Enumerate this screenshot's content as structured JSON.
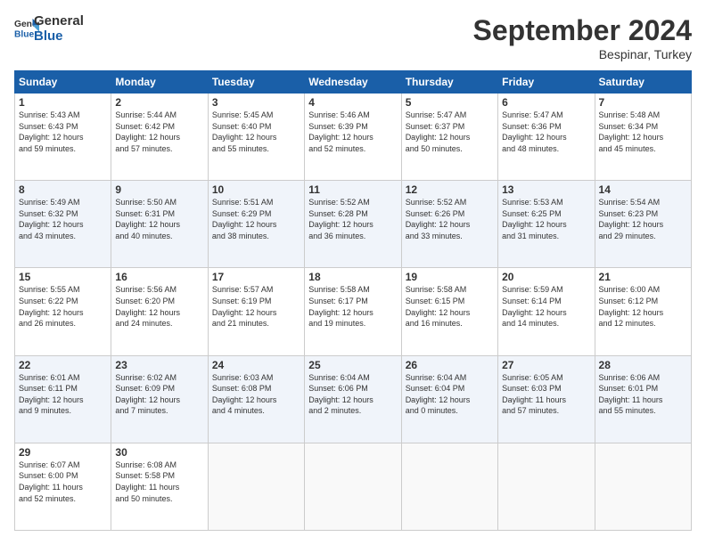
{
  "logo": {
    "line1": "General",
    "line2": "Blue"
  },
  "title": "September 2024",
  "subtitle": "Bespinar, Turkey",
  "weekdays": [
    "Sunday",
    "Monday",
    "Tuesday",
    "Wednesday",
    "Thursday",
    "Friday",
    "Saturday"
  ],
  "weeks": [
    [
      {
        "day": "1",
        "info": "Sunrise: 5:43 AM\nSunset: 6:43 PM\nDaylight: 12 hours\nand 59 minutes."
      },
      {
        "day": "2",
        "info": "Sunrise: 5:44 AM\nSunset: 6:42 PM\nDaylight: 12 hours\nand 57 minutes."
      },
      {
        "day": "3",
        "info": "Sunrise: 5:45 AM\nSunset: 6:40 PM\nDaylight: 12 hours\nand 55 minutes."
      },
      {
        "day": "4",
        "info": "Sunrise: 5:46 AM\nSunset: 6:39 PM\nDaylight: 12 hours\nand 52 minutes."
      },
      {
        "day": "5",
        "info": "Sunrise: 5:47 AM\nSunset: 6:37 PM\nDaylight: 12 hours\nand 50 minutes."
      },
      {
        "day": "6",
        "info": "Sunrise: 5:47 AM\nSunset: 6:36 PM\nDaylight: 12 hours\nand 48 minutes."
      },
      {
        "day": "7",
        "info": "Sunrise: 5:48 AM\nSunset: 6:34 PM\nDaylight: 12 hours\nand 45 minutes."
      }
    ],
    [
      {
        "day": "8",
        "info": "Sunrise: 5:49 AM\nSunset: 6:32 PM\nDaylight: 12 hours\nand 43 minutes."
      },
      {
        "day": "9",
        "info": "Sunrise: 5:50 AM\nSunset: 6:31 PM\nDaylight: 12 hours\nand 40 minutes."
      },
      {
        "day": "10",
        "info": "Sunrise: 5:51 AM\nSunset: 6:29 PM\nDaylight: 12 hours\nand 38 minutes."
      },
      {
        "day": "11",
        "info": "Sunrise: 5:52 AM\nSunset: 6:28 PM\nDaylight: 12 hours\nand 36 minutes."
      },
      {
        "day": "12",
        "info": "Sunrise: 5:52 AM\nSunset: 6:26 PM\nDaylight: 12 hours\nand 33 minutes."
      },
      {
        "day": "13",
        "info": "Sunrise: 5:53 AM\nSunset: 6:25 PM\nDaylight: 12 hours\nand 31 minutes."
      },
      {
        "day": "14",
        "info": "Sunrise: 5:54 AM\nSunset: 6:23 PM\nDaylight: 12 hours\nand 29 minutes."
      }
    ],
    [
      {
        "day": "15",
        "info": "Sunrise: 5:55 AM\nSunset: 6:22 PM\nDaylight: 12 hours\nand 26 minutes."
      },
      {
        "day": "16",
        "info": "Sunrise: 5:56 AM\nSunset: 6:20 PM\nDaylight: 12 hours\nand 24 minutes."
      },
      {
        "day": "17",
        "info": "Sunrise: 5:57 AM\nSunset: 6:19 PM\nDaylight: 12 hours\nand 21 minutes."
      },
      {
        "day": "18",
        "info": "Sunrise: 5:58 AM\nSunset: 6:17 PM\nDaylight: 12 hours\nand 19 minutes."
      },
      {
        "day": "19",
        "info": "Sunrise: 5:58 AM\nSunset: 6:15 PM\nDaylight: 12 hours\nand 16 minutes."
      },
      {
        "day": "20",
        "info": "Sunrise: 5:59 AM\nSunset: 6:14 PM\nDaylight: 12 hours\nand 14 minutes."
      },
      {
        "day": "21",
        "info": "Sunrise: 6:00 AM\nSunset: 6:12 PM\nDaylight: 12 hours\nand 12 minutes."
      }
    ],
    [
      {
        "day": "22",
        "info": "Sunrise: 6:01 AM\nSunset: 6:11 PM\nDaylight: 12 hours\nand 9 minutes."
      },
      {
        "day": "23",
        "info": "Sunrise: 6:02 AM\nSunset: 6:09 PM\nDaylight: 12 hours\nand 7 minutes."
      },
      {
        "day": "24",
        "info": "Sunrise: 6:03 AM\nSunset: 6:08 PM\nDaylight: 12 hours\nand 4 minutes."
      },
      {
        "day": "25",
        "info": "Sunrise: 6:04 AM\nSunset: 6:06 PM\nDaylight: 12 hours\nand 2 minutes."
      },
      {
        "day": "26",
        "info": "Sunrise: 6:04 AM\nSunset: 6:04 PM\nDaylight: 12 hours\nand 0 minutes."
      },
      {
        "day": "27",
        "info": "Sunrise: 6:05 AM\nSunset: 6:03 PM\nDaylight: 11 hours\nand 57 minutes."
      },
      {
        "day": "28",
        "info": "Sunrise: 6:06 AM\nSunset: 6:01 PM\nDaylight: 11 hours\nand 55 minutes."
      }
    ],
    [
      {
        "day": "29",
        "info": "Sunrise: 6:07 AM\nSunset: 6:00 PM\nDaylight: 11 hours\nand 52 minutes."
      },
      {
        "day": "30",
        "info": "Sunrise: 6:08 AM\nSunset: 5:58 PM\nDaylight: 11 hours\nand 50 minutes."
      },
      {
        "day": "",
        "info": ""
      },
      {
        "day": "",
        "info": ""
      },
      {
        "day": "",
        "info": ""
      },
      {
        "day": "",
        "info": ""
      },
      {
        "day": "",
        "info": ""
      }
    ]
  ]
}
